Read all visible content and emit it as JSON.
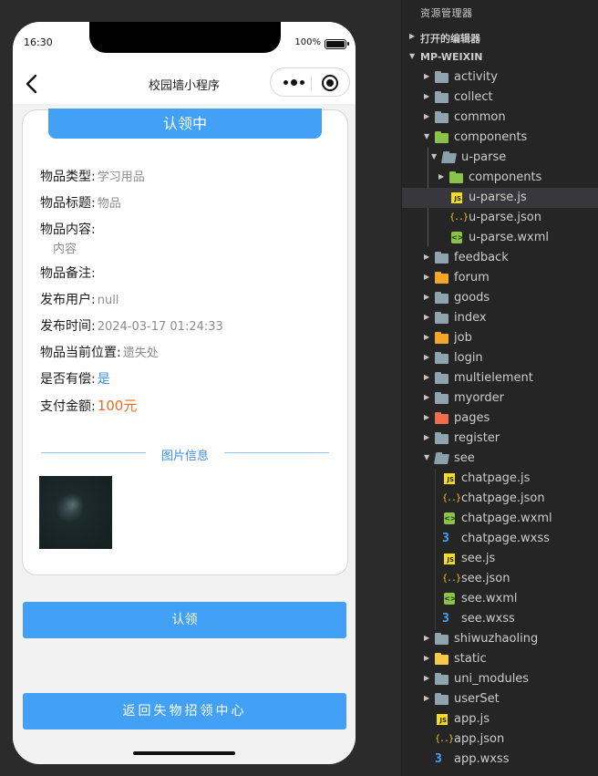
{
  "phone": {
    "status": {
      "time": "16:30",
      "battery": "100%"
    },
    "nav": {
      "title": "校园墙小程序"
    },
    "card": {
      "status_chip": "认领中",
      "fields": {
        "type_label": "物品类型:",
        "type_value": "学习用品",
        "title_label": "物品标题:",
        "title_value": "物品",
        "content_label": "物品内容:",
        "content_value": "内容",
        "remark_label": "物品备注:",
        "user_label": "发布用户:",
        "user_value": "null",
        "time_label": "发布时间:",
        "time_value": "2024-03-17 01:24:33",
        "location_label": "物品当前位置:",
        "location_value": "遗失处",
        "reward_label": "是否有偿:",
        "reward_value": "是",
        "amount_label": "支付金额:",
        "amount_value": "100元"
      },
      "image_section_label": "图片信息"
    },
    "buttons": {
      "claim": "认领",
      "return": "返回失物招领中心"
    }
  },
  "explorer": {
    "header": "资源管理器",
    "open_editors": "打开的编辑器",
    "project": "MP-WEIXIN",
    "items": [
      {
        "name": "activity",
        "icon": "folder-icon"
      },
      {
        "name": "collect",
        "icon": "folder-icon"
      },
      {
        "name": "common",
        "icon": "folder-icon"
      },
      {
        "name": "components",
        "icon": "folder-components-icon"
      },
      {
        "name": "u-parse",
        "icon": "folder-open-icon"
      },
      {
        "name": "components",
        "icon": "folder-components-icon"
      },
      {
        "name": "u-parse.js",
        "icon": "js-file-icon"
      },
      {
        "name": "u-parse.json",
        "icon": "json-file-icon"
      },
      {
        "name": "u-parse.wxml",
        "icon": "wxml-file-icon"
      },
      {
        "name": "feedback",
        "icon": "folder-icon"
      },
      {
        "name": "forum",
        "icon": "folder-forum-icon"
      },
      {
        "name": "goods",
        "icon": "folder-icon"
      },
      {
        "name": "index",
        "icon": "folder-icon"
      },
      {
        "name": "job",
        "icon": "folder-job-icon"
      },
      {
        "name": "login",
        "icon": "folder-icon"
      },
      {
        "name": "multielement",
        "icon": "folder-icon"
      },
      {
        "name": "myorder",
        "icon": "folder-icon"
      },
      {
        "name": "pages",
        "icon": "folder-pages-icon"
      },
      {
        "name": "register",
        "icon": "folder-icon"
      },
      {
        "name": "see",
        "icon": "folder-open-icon"
      },
      {
        "name": "chatpage.js",
        "icon": "js-file-icon"
      },
      {
        "name": "chatpage.json",
        "icon": "json-file-icon"
      },
      {
        "name": "chatpage.wxml",
        "icon": "wxml-file-icon"
      },
      {
        "name": "chatpage.wxss",
        "icon": "wxss-file-icon"
      },
      {
        "name": "see.js",
        "icon": "js-file-icon"
      },
      {
        "name": "see.json",
        "icon": "json-file-icon"
      },
      {
        "name": "see.wxml",
        "icon": "wxml-file-icon"
      },
      {
        "name": "see.wxss",
        "icon": "wxss-file-icon"
      },
      {
        "name": "shiwuzhaoling",
        "icon": "folder-icon"
      },
      {
        "name": "static",
        "icon": "folder-static-icon"
      },
      {
        "name": "uni_modules",
        "icon": "folder-icon"
      },
      {
        "name": "userSet",
        "icon": "folder-icon"
      },
      {
        "name": "app.js",
        "icon": "js-file-icon"
      },
      {
        "name": "app.json",
        "icon": "json-file-icon"
      },
      {
        "name": "app.wxss",
        "icon": "wxss-file-icon"
      }
    ]
  },
  "colors": {
    "accent_blue": "#42a0f5",
    "link_blue": "#3b8fe0",
    "amount_orange": "#f06a1f",
    "explorer_bg": "#252526"
  }
}
